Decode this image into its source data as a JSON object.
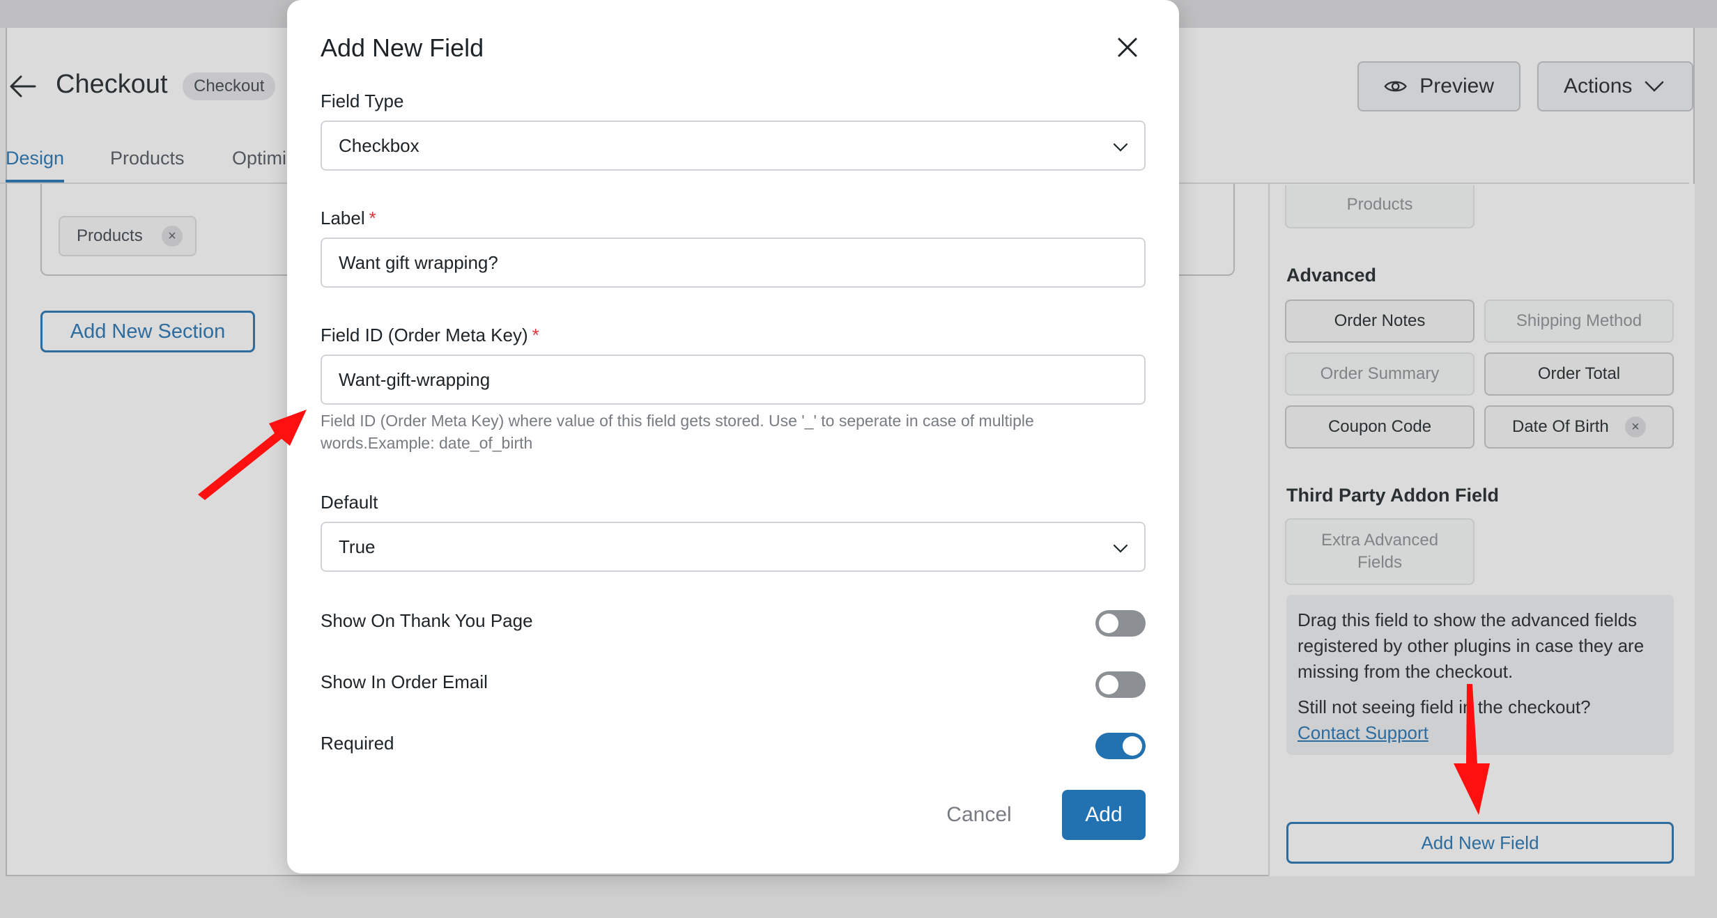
{
  "header": {
    "title": "Checkout",
    "badge": "Checkout",
    "preview_label": "Preview",
    "actions_label": "Actions"
  },
  "tabs": [
    {
      "label": "Design",
      "active": true
    },
    {
      "label": "Products",
      "active": false
    },
    {
      "label": "Optimi",
      "active": false
    }
  ],
  "left_panel": {
    "product_chip": "Products",
    "add_section_label": "Add New Section"
  },
  "sidebar": {
    "top_chip": "Products",
    "advanced_heading": "Advanced",
    "advanced_fields": [
      {
        "label": "Order Notes",
        "enabled": true
      },
      {
        "label": "Shipping Method",
        "enabled": false
      },
      {
        "label": "Order Summary",
        "enabled": false
      },
      {
        "label": "Order Total",
        "enabled": true
      },
      {
        "label": "Coupon Code",
        "enabled": true
      },
      {
        "label": "Date Of Birth",
        "enabled": true
      }
    ],
    "third_party_heading": "Third Party Addon Field",
    "extra_fields_line1": "Extra Advanced",
    "extra_fields_line2": "Fields",
    "info_text": "Drag this field to show the advanced fields registered by other plugins in case they are missing from the checkout.",
    "info_text_2": "Still not seeing field in the checkout?",
    "contact_support": "Contact Support",
    "add_field_label": "Add New Field"
  },
  "modal": {
    "title": "Add New Field",
    "field_type_label": "Field Type",
    "field_type_value": "Checkbox",
    "label_label": "Label",
    "label_value": "Want gift wrapping?",
    "field_id_label": "Field ID (Order Meta Key)",
    "field_id_value": "Want-gift-wrapping",
    "required_mark": "*",
    "field_id_hint": "Field ID (Order Meta Key) where value of this field gets stored. Use '_' to seperate in case of multiple words.Example: date_of_birth",
    "default_label": "Default",
    "default_value": "True",
    "toggles": [
      {
        "label": "Show On Thank You Page",
        "on": false
      },
      {
        "label": "Show In Order Email",
        "on": false
      },
      {
        "label": "Required",
        "on": true
      }
    ],
    "cancel_label": "Cancel",
    "add_label": "Add"
  },
  "colors": {
    "accent": "#2271b1",
    "annotation_arrow": "#ff0000",
    "required": "#d63638"
  }
}
